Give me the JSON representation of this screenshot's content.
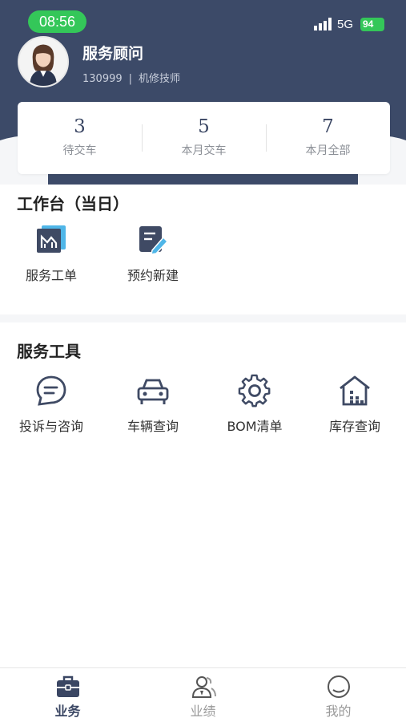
{
  "status_bar": {
    "time": "08:56",
    "network": "5G",
    "battery": "94"
  },
  "user": {
    "name": "服务顾问",
    "id": "130999",
    "separator": "|",
    "role": "机修技师"
  },
  "stats": [
    {
      "value": "3",
      "label": "待交车"
    },
    {
      "value": "5",
      "label": "本月交车"
    },
    {
      "value": "7",
      "label": "本月全部"
    }
  ],
  "workbench": {
    "title": "工作台（当日）",
    "items": [
      {
        "label": "服务工单",
        "icon": "chart-report-icon"
      },
      {
        "label": "预约新建",
        "icon": "document-edit-icon"
      }
    ]
  },
  "tools": {
    "title": "服务工具",
    "items": [
      {
        "label": "投诉与咨询",
        "icon": "chat-bubble-icon"
      },
      {
        "label": "车辆查询",
        "icon": "car-icon"
      },
      {
        "label": "BOM清单",
        "icon": "gear-icon"
      },
      {
        "label": "库存查询",
        "icon": "warehouse-icon"
      }
    ]
  },
  "tabbar": [
    {
      "label": "业务",
      "icon": "briefcase-icon",
      "active": true
    },
    {
      "label": "业绩",
      "icon": "users-icon",
      "active": false
    },
    {
      "label": "我的",
      "icon": "profile-circle-icon",
      "active": false
    }
  ],
  "colors": {
    "header": "#3c4a68",
    "accent": "#3a4663",
    "icon_highlight": "#4fb6e8",
    "status_green": "#34c759"
  }
}
